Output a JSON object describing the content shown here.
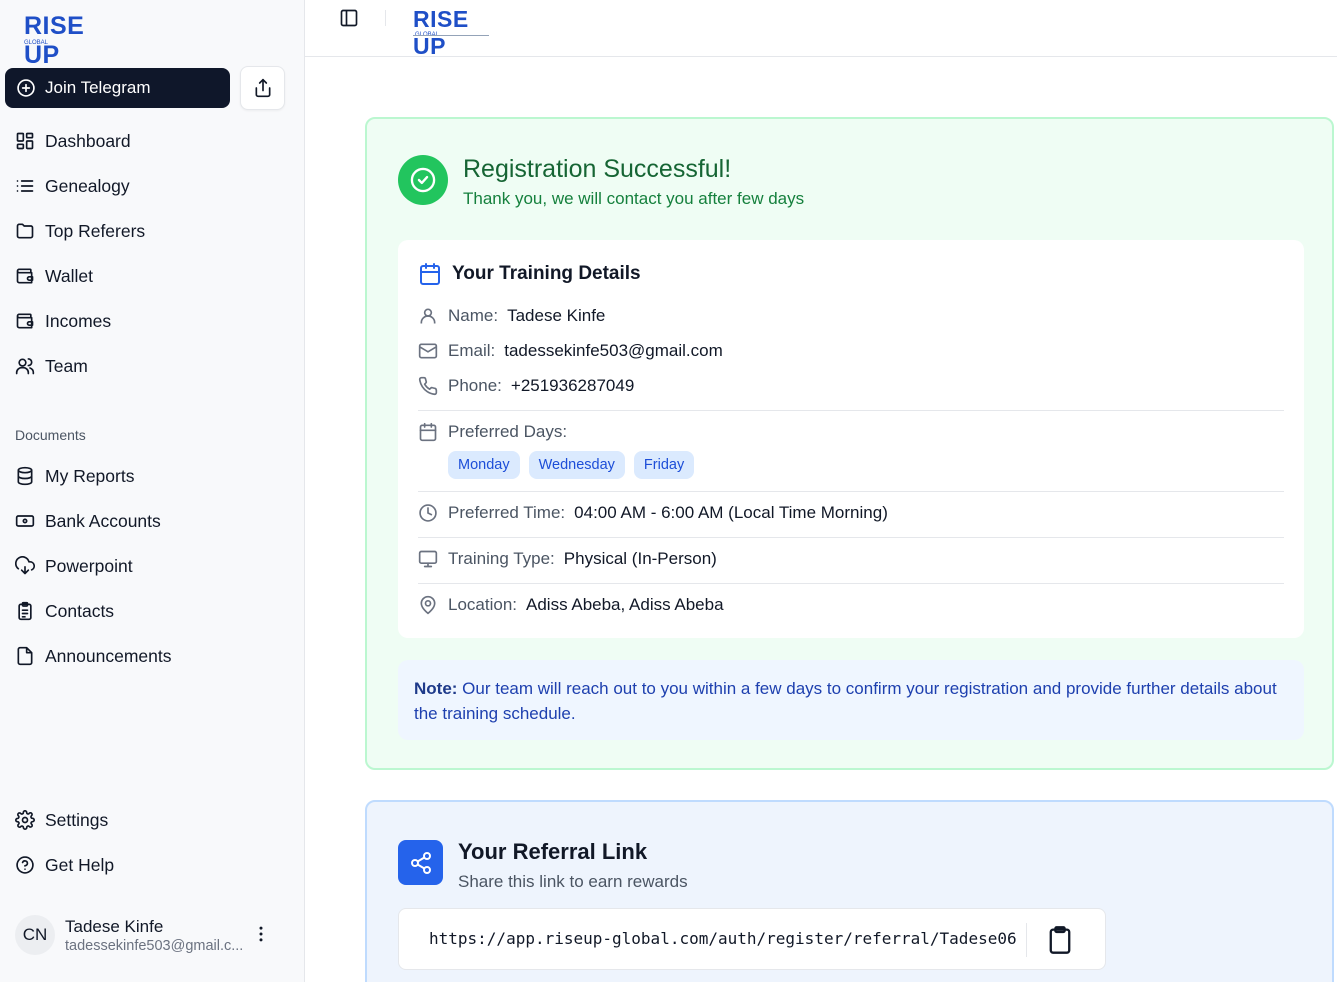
{
  "brand": {
    "name": "RISE UP",
    "sub": "GLOBAL"
  },
  "sidebar": {
    "join_telegram": "Join Telegram",
    "nav": [
      {
        "label": "Dashboard",
        "icon": "dashboard-icon"
      },
      {
        "label": "Genealogy",
        "icon": "list-icon"
      },
      {
        "label": "Top Referers",
        "icon": "folder-icon"
      },
      {
        "label": "Wallet",
        "icon": "wallet-icon"
      },
      {
        "label": "Incomes",
        "icon": "wallet-icon"
      },
      {
        "label": "Team",
        "icon": "users-icon"
      }
    ],
    "documents_label": "Documents",
    "documents": [
      {
        "label": "My Reports",
        "icon": "database-icon"
      },
      {
        "label": "Bank Accounts",
        "icon": "banknote-icon"
      },
      {
        "label": "Powerpoint",
        "icon": "cloud-download-icon"
      },
      {
        "label": "Contacts",
        "icon": "clipboard-list-icon"
      },
      {
        "label": "Announcements",
        "icon": "file-icon"
      }
    ],
    "settings": "Settings",
    "help": "Get Help",
    "user": {
      "initials": "CN",
      "name": "Tadese Kinfe",
      "email": "tadessekinfe503@gmail.c..."
    }
  },
  "success": {
    "title": "Registration Successful!",
    "subtitle": "Thank you, we will contact you after few days",
    "details_title": "Your Training Details",
    "name_label": "Name:",
    "name_value": "Tadese Kinfe",
    "email_label": "Email:",
    "email_value": "tadessekinfe503@gmail.com",
    "phone_label": "Phone:",
    "phone_value": "+251936287049",
    "days_label": "Preferred Days:",
    "days": [
      "Monday",
      "Wednesday",
      "Friday"
    ],
    "time_label": "Preferred Time:",
    "time_value": "04:00 AM - 6:00 AM (Local Time Morning)",
    "type_label": "Training Type:",
    "type_value": "Physical (In-Person)",
    "location_label": "Location:",
    "location_value": "Adiss Abeba, Adiss Abeba",
    "note_label": "Note:",
    "note_text": " Our team will reach out to you within a few days to confirm your registration and provide further details about the training schedule."
  },
  "referral": {
    "title": "Your Referral Link",
    "subtitle": "Share this link to earn rewards",
    "link": "https://app.riseup-global.com/auth/register/referral/Tadese06"
  },
  "colors": {
    "primary_dark": "#0f172a",
    "success": "#22c55e",
    "accent_blue": "#2563eb"
  }
}
